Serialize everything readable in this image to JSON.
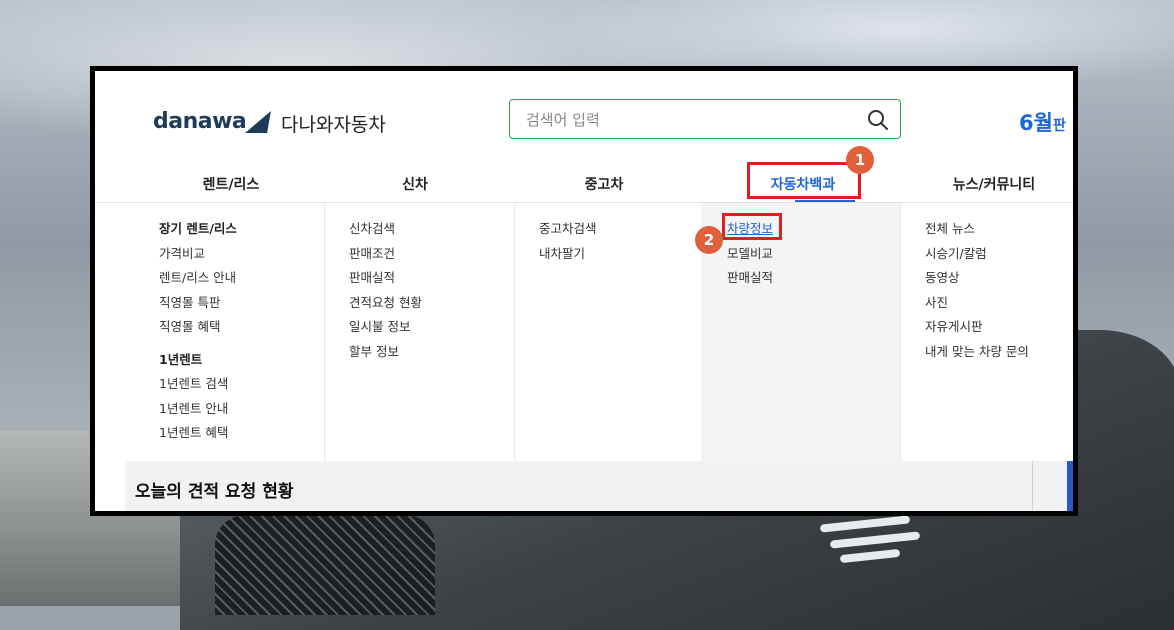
{
  "header": {
    "logo_text": "danawa",
    "logo_sub": "다나와자동차",
    "search_placeholder": "검색어 입력",
    "promo_month": "6월",
    "promo_suffix": "판"
  },
  "nav": {
    "items": [
      "렌트/리스",
      "신차",
      "중고차",
      "자동차백과",
      "뉴스/커뮤니티"
    ],
    "active_index": 3
  },
  "menu": {
    "rent": {
      "title1": "장기 렌트/리스",
      "items1": [
        "가격비교",
        "렌트/리스 안내",
        "직영몰 특판",
        "직영몰 혜택"
      ],
      "title2": "1년렌트",
      "items2": [
        "1년렌트 검색",
        "1년렌트 안내",
        "1년렌트 혜택"
      ]
    },
    "newcar": [
      "신차검색",
      "판매조건",
      "판매실적",
      "견적요청 현황",
      "일시불 정보",
      "할부 정보"
    ],
    "used": [
      "중고차검색",
      "내차팔기"
    ],
    "encyclopedia": [
      "차량정보",
      "모델비교",
      "판매실적"
    ],
    "news": [
      "전체 뉴스",
      "시승기/칼럼",
      "동영상",
      "사진",
      "자유게시판",
      "내게 맞는 차량 문의"
    ]
  },
  "annotations": {
    "step1": "1",
    "step2": "2",
    "highlight_color": "#e02020",
    "badge_color": "#e0603a"
  },
  "bottom": {
    "title": "오늘의 견적 요청 현황"
  },
  "colors": {
    "accent": "#1e66d8",
    "brand": "#1f3b5a",
    "search_border": "#2aa34a"
  }
}
